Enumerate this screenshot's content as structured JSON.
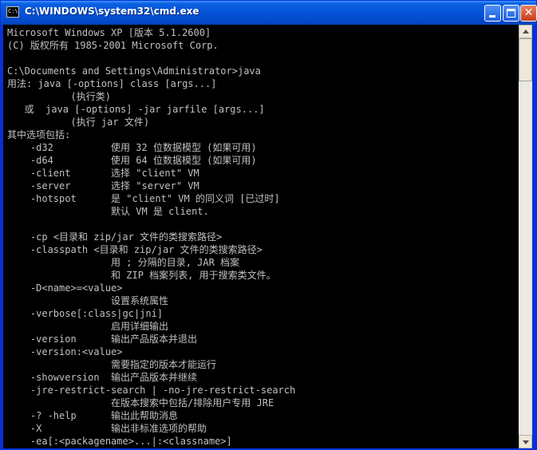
{
  "window": {
    "title": "C:\\WINDOWS\\system32\\cmd.exe",
    "icon_text": "C:\\",
    "icon": "cmd-icon",
    "minimize_icon": "minimize-icon",
    "maximize_icon": "maximize-icon",
    "close_icon": "close-icon",
    "close_glyph": "✕",
    "title_color": "#0453d8"
  },
  "console": {
    "background": "#000000",
    "foreground": "#c0c0c0",
    "lines": [
      "Microsoft Windows XP [版本 5.1.2600]",
      "(C) 版权所有 1985-2001 Microsoft Corp.",
      "",
      "C:\\Documents and Settings\\Administrator>java",
      "用法: java [-options] class [args...]",
      "           (执行类)",
      "   或  java [-options] -jar jarfile [args...]",
      "           (执行 jar 文件)",
      "其中选项包括:",
      "    -d32          使用 32 位数据模型 (如果可用)",
      "    -d64          使用 64 位数据模型 (如果可用)",
      "    -client       选择 \"client\" VM",
      "    -server       选择 \"server\" VM",
      "    -hotspot      是 \"client\" VM 的同义词 [已过时]",
      "                  默认 VM 是 client.",
      "",
      "    -cp <目录和 zip/jar 文件的类搜索路径>",
      "    -classpath <目录和 zip/jar 文件的类搜索路径>",
      "                  用 ; 分隔的目录, JAR 档案",
      "                  和 ZIP 档案列表, 用于搜索类文件。",
      "    -D<name>=<value>",
      "                  设置系统属性",
      "    -verbose[:class|gc|jni]",
      "                  启用详细输出",
      "    -version      输出产品版本并退出",
      "    -version:<value>",
      "                  需要指定的版本才能运行",
      "    -showversion  输出产品版本并继续",
      "    -jre-restrict-search | -no-jre-restrict-search",
      "                  在版本搜索中包括/排除用户专用 JRE",
      "    -? -help      输出此帮助消息",
      "    -X            输出非标准选项的帮助",
      "    -ea[:<packagename>...|:<classname>]"
    ]
  },
  "scrollbar": {
    "up_icon": "scroll-up-arrow-icon",
    "down_icon": "scroll-down-arrow-icon"
  }
}
